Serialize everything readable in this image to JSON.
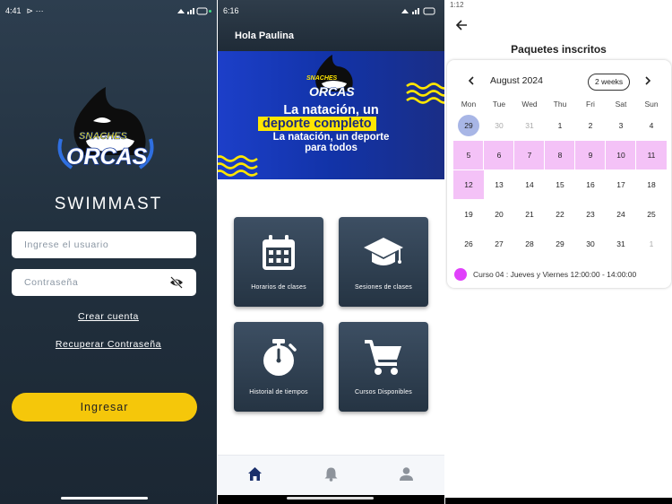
{
  "screen1": {
    "status_time": "4:41",
    "status_icons": "⊳ ···",
    "logo_line1": "SNACHES",
    "logo_line2": "ORCAS",
    "app_name": "SWIMMAST",
    "username_placeholder": "Ingrese el usuario",
    "password_placeholder": "Contraseña",
    "create_account": "Crear cuenta",
    "recover_password": "Recuperar Contraseña",
    "login_button": "Ingresar"
  },
  "screen2": {
    "status_time": "6:16",
    "greeting": "Hola Paulina",
    "banner": {
      "logo_line1": "SNACHES",
      "logo_line2": "ORCAS",
      "line1": "La natación, un",
      "line2": "deporte completo",
      "line3": "La natación, un deporte",
      "line4": "para todos"
    },
    "tiles": [
      {
        "label": "Horarios de clases",
        "icon": "calendar-icon"
      },
      {
        "label": "Sesiones de clases",
        "icon": "graduation-cap-icon"
      },
      {
        "label": "Historial de tiempos",
        "icon": "stopwatch-icon"
      },
      {
        "label": "Cursos Disponibles",
        "icon": "shopping-cart-icon"
      }
    ],
    "bottom_nav": [
      "home-icon",
      "bell-icon",
      "person-icon"
    ]
  },
  "screen3": {
    "status_time": "1:12",
    "title": "Paquetes inscritos",
    "month": "August 2024",
    "view_toggle": "2 weeks",
    "weekdays": [
      "Mon",
      "Tue",
      "Wed",
      "Thu",
      "Fri",
      "Sat",
      "Sun"
    ],
    "weeks": [
      [
        "29",
        "30",
        "31",
        "1",
        "2",
        "3",
        "4"
      ],
      [
        "5",
        "6",
        "7",
        "8",
        "9",
        "10",
        "11"
      ],
      [
        "12",
        "13",
        "14",
        "15",
        "16",
        "17",
        "18"
      ],
      [
        "19",
        "20",
        "21",
        "22",
        "23",
        "24",
        "25"
      ],
      [
        "26",
        "27",
        "28",
        "29",
        "30",
        "31",
        "1"
      ]
    ],
    "legend": {
      "text": "Curso 04 : Jueves y Viernes  12:00:00 - 14:00:00",
      "color": "#e040fb"
    },
    "colors": {
      "selected": "#f4c2f7",
      "today": "#a8b6e6"
    }
  }
}
